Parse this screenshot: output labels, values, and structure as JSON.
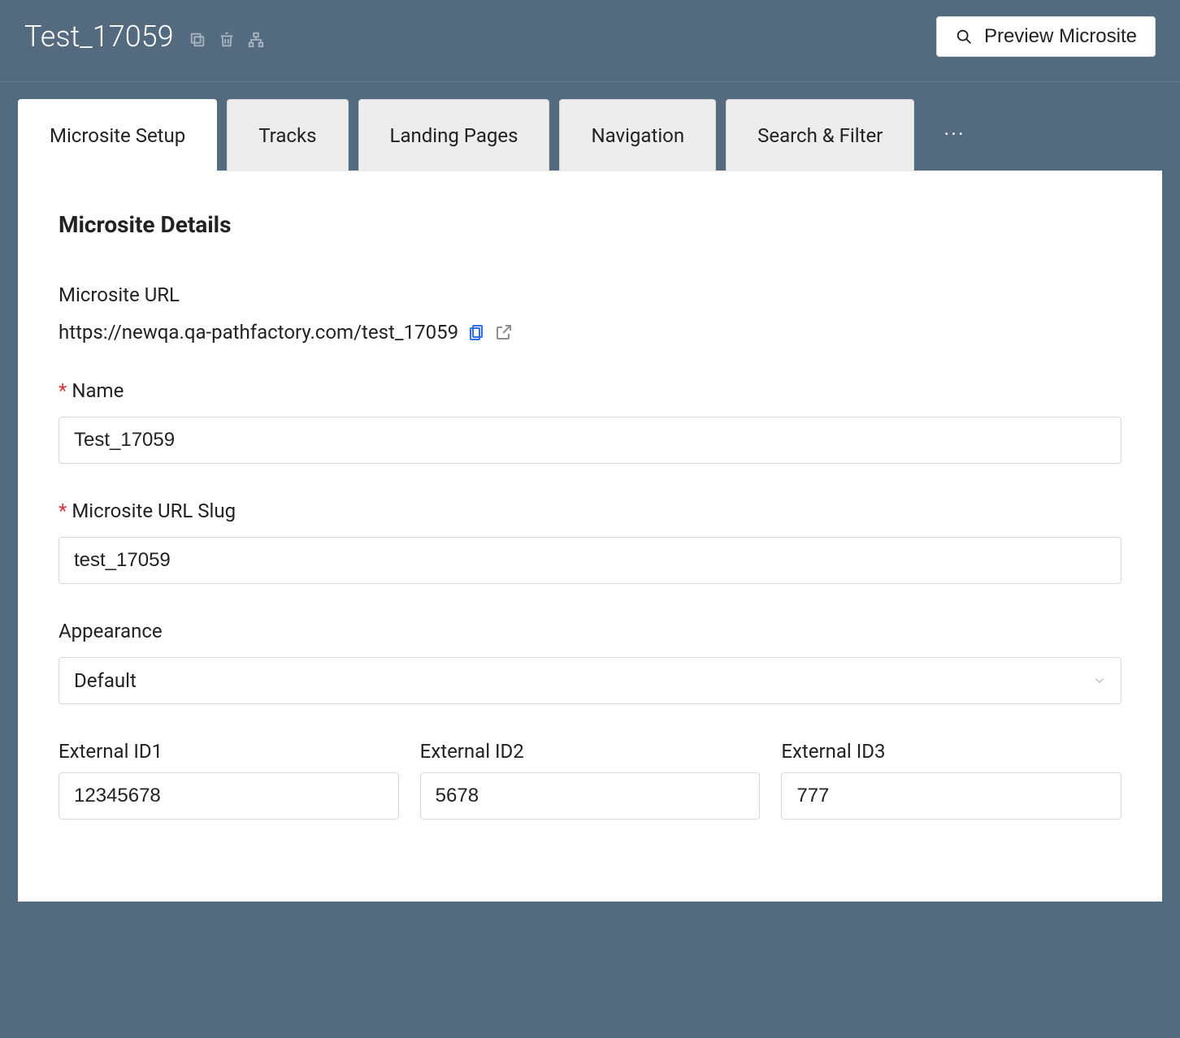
{
  "header": {
    "title": "Test_17059",
    "preview_label": "Preview Microsite"
  },
  "tabs": [
    {
      "label": "Microsite Setup"
    },
    {
      "label": "Tracks"
    },
    {
      "label": "Landing Pages"
    },
    {
      "label": "Navigation"
    },
    {
      "label": "Search & Filter"
    }
  ],
  "details": {
    "section_title": "Microsite Details",
    "url_label": "Microsite URL",
    "url_value": "https://newqa.qa-pathfactory.com/test_17059",
    "name_label": "Name",
    "name_value": "Test_17059",
    "slug_label": "Microsite URL Slug",
    "slug_value": "test_17059",
    "appearance_label": "Appearance",
    "appearance_value": "Default",
    "external1_label": "External ID1",
    "external1_value": "12345678",
    "external2_label": "External ID2",
    "external2_value": "5678",
    "external3_label": "External ID3",
    "external3_value": "777"
  }
}
